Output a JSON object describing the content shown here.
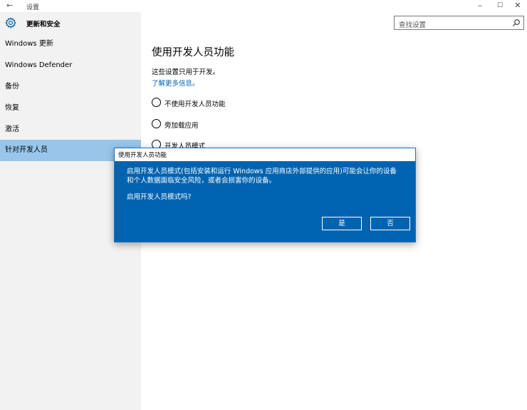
{
  "window": {
    "back_glyph": "←",
    "title": "设置",
    "minimize_glyph": "–",
    "maximize_glyph": "☐",
    "close_glyph": "✕"
  },
  "sidebar": {
    "header_title": "更新和安全",
    "items": [
      {
        "label": "Windows 更新"
      },
      {
        "label": "Windows Defender"
      },
      {
        "label": "备份"
      },
      {
        "label": "恢复"
      },
      {
        "label": "激活"
      },
      {
        "label": "针对开发人员"
      }
    ],
    "active_index": 5
  },
  "search": {
    "placeholder": "查找设置"
  },
  "main": {
    "title": "使用开发人员功能",
    "description": "这些设置只用于开发。",
    "link": "了解更多信息。",
    "radios": [
      {
        "label": "不使用开发人员功能"
      },
      {
        "label": "旁加载应用"
      },
      {
        "label": "开发人员模式"
      }
    ]
  },
  "dialog": {
    "title": "使用开发人员功能",
    "line1": "启用开发人员模式(包括安装和运行 Windows 应用商店外部提供的应用)可能会让你的设备",
    "line2": "和个人数据面临安全风险，或者会损害你的设备。",
    "question": "启用开发人员模式吗?",
    "yes_label": "是",
    "no_label": "否"
  },
  "colors": {
    "accent": "#0063b1",
    "sidebar_bg": "#f2f2f2",
    "active_item": "#99c5eb"
  }
}
